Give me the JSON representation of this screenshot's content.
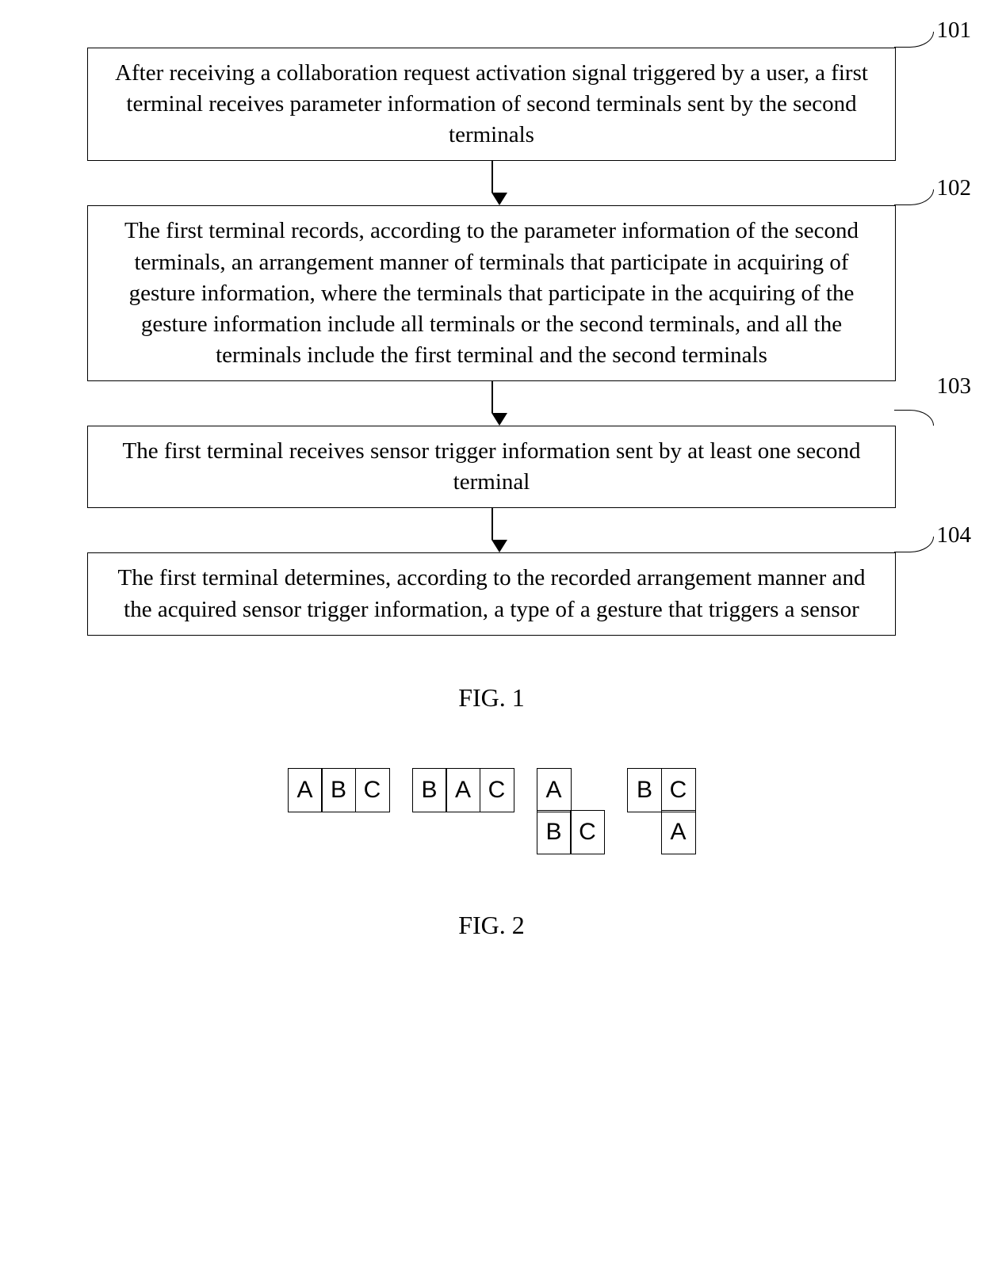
{
  "flowchart": {
    "steps": [
      {
        "id": "101",
        "text": "After receiving a collaboration request activation signal triggered by a user, a first terminal receives parameter information of second terminals sent by the second terminals"
      },
      {
        "id": "102",
        "text": "The first terminal records, according to the parameter information of the second terminals, an arrangement manner of terminals that participate in acquiring of gesture information, where the terminals that participate in the acquiring of the gesture information include all terminals or the second terminals, and all the terminals include the first terminal and the second terminals"
      },
      {
        "id": "103",
        "text": "The first terminal receives sensor trigger information sent by at least one second terminal"
      },
      {
        "id": "104",
        "text": "The first terminal determines, according to the recorded arrangement manner and the acquired sensor trigger information, a type of a gesture that triggers a sensor"
      }
    ],
    "caption": "FIG. 1"
  },
  "fig2": {
    "arrangements": [
      {
        "rows": [
          [
            "A",
            "B",
            "C"
          ]
        ]
      },
      {
        "rows": [
          [
            "B",
            "A",
            "C"
          ]
        ]
      },
      {
        "rows": [
          [
            "A",
            "",
            ""
          ],
          [
            "",
            "B",
            "C"
          ]
        ]
      },
      {
        "rows": [
          [
            "B",
            "C"
          ],
          [
            "",
            "A"
          ]
        ]
      }
    ],
    "caption": "FIG. 2"
  }
}
